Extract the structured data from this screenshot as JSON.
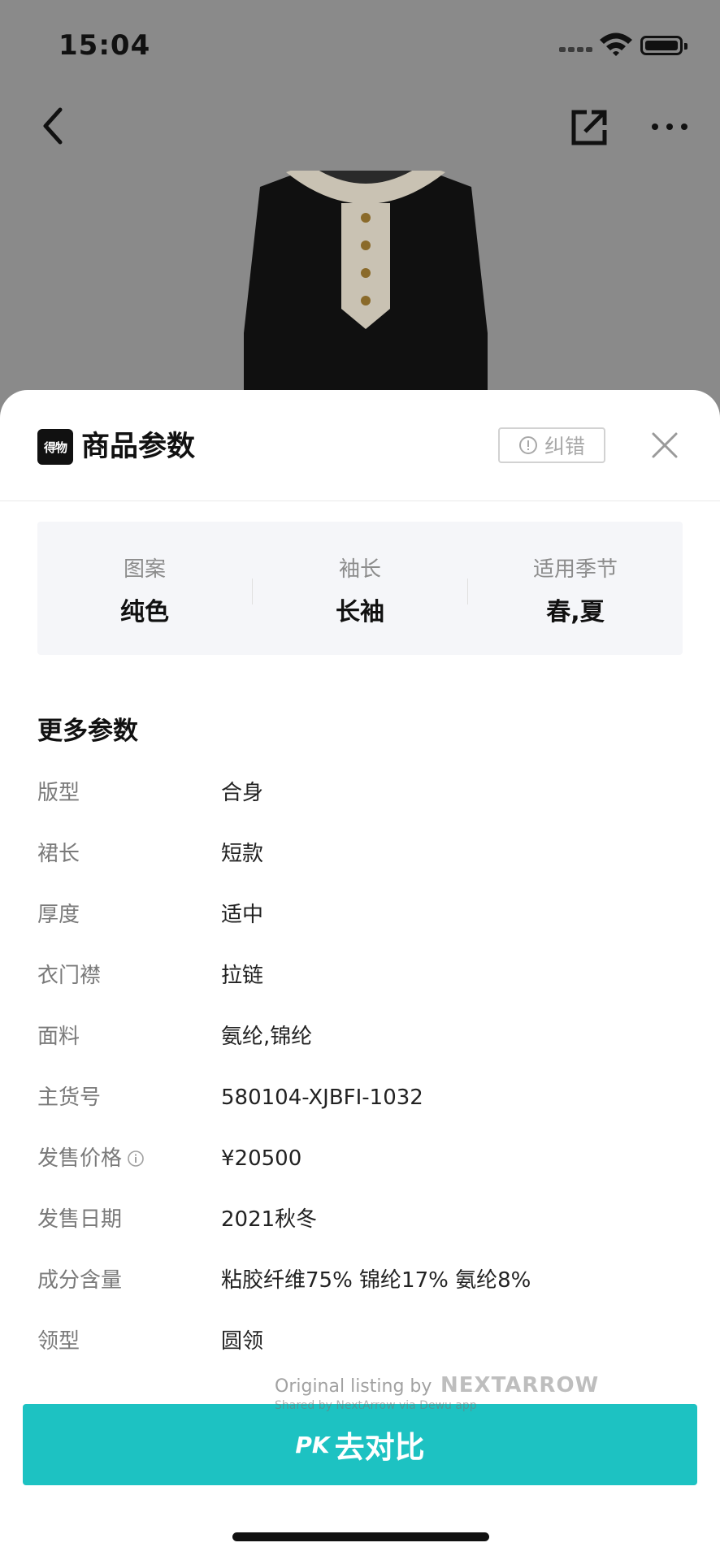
{
  "status_bar": {
    "time": "15:04"
  },
  "nav": {
    "back_icon": "chevron-left-icon",
    "share_icon": "external-share-icon",
    "more_icon": "more-horizontal-icon"
  },
  "sheet": {
    "app_logo_text": "得物",
    "title": "商品参数",
    "report_button": "纠错",
    "close_icon": "close-icon"
  },
  "summary": [
    {
      "label": "图案",
      "value": "纯色"
    },
    {
      "label": "袖长",
      "value": "长袖"
    },
    {
      "label": "适用季节",
      "value": "春,夏"
    }
  ],
  "more_params": {
    "title": "更多参数",
    "items": [
      {
        "label": "版型",
        "value": "合身"
      },
      {
        "label": "裙长",
        "value": "短款"
      },
      {
        "label": "厚度",
        "value": "适中"
      },
      {
        "label": "衣门襟",
        "value": "拉链"
      },
      {
        "label": "面料",
        "value": "氨纶,锦纶"
      },
      {
        "label": "主货号",
        "value": "580104-XJBFI-1032"
      },
      {
        "label": "发售价格",
        "value": "¥20500"
      },
      {
        "label": "发售日期",
        "value": "2021秋冬"
      },
      {
        "label": "成分含量",
        "value": "粘胶纤维75% 锦纶17% 氨纶8%"
      },
      {
        "label": "领型",
        "value": "圆领"
      }
    ]
  },
  "watermark": {
    "text": "Original listing by",
    "brand": "NEXTARROW",
    "sub": "Shared by NextArrow via Dewu app"
  },
  "pk_button": {
    "prefix": "PK",
    "label": "去对比"
  },
  "colors": {
    "accent": "#1dc2c2",
    "overlay": "#8a8a8a"
  }
}
